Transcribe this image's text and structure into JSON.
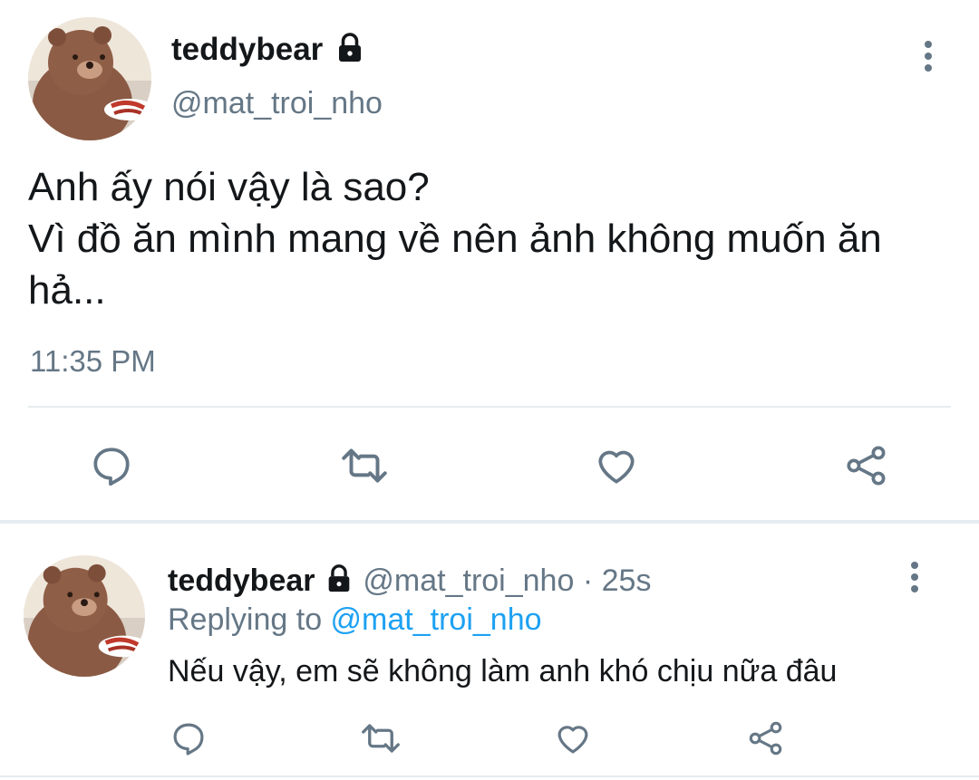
{
  "main_tweet": {
    "display_name": "teddybear",
    "handle": "@mat_troi_nho",
    "text": "Anh ấy nói vậy là sao?\nVì đồ ăn mình mang về nên ảnh không muốn ăn\nhả...",
    "timestamp": "11:35 PM",
    "actions": [
      "reply-icon",
      "retweet-icon",
      "like-icon",
      "share-icon"
    ]
  },
  "reply_tweet": {
    "display_name": "teddybear",
    "handle": "@mat_troi_nho",
    "separator": "·",
    "age": "25s",
    "replying_prefix": "Replying to ",
    "replying_to": "@mat_troi_nho",
    "text": "Nếu vậy, em sẽ không làm anh khó chịu nữa đâu",
    "actions": [
      "reply-icon",
      "retweet-icon",
      "like-icon",
      "share-icon"
    ]
  },
  "colors": {
    "text": "#14171a",
    "muted": "#657786",
    "link": "#1da1f2",
    "divider": "#e6ecf0"
  }
}
